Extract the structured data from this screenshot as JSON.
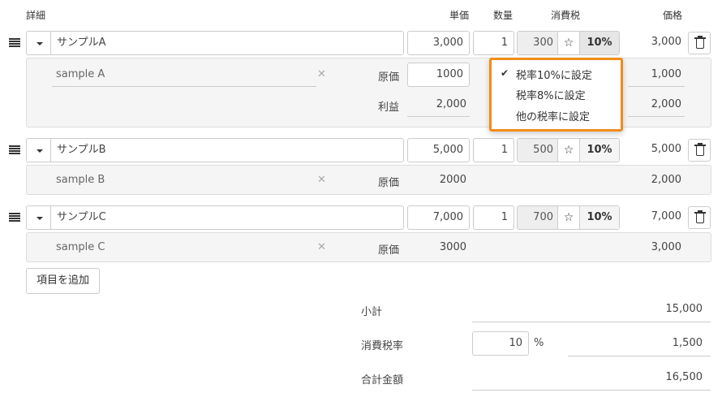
{
  "headers": {
    "detail": "詳細",
    "unit_price": "単価",
    "quantity": "数量",
    "tax": "消費税",
    "price": "価格"
  },
  "items": [
    {
      "name": "サンプルA",
      "unit_price": "3,000",
      "quantity": "1",
      "tax_amount": "300",
      "tax_rate": "10%",
      "price": "3,000",
      "description": "sample A",
      "cost_label": "原価",
      "cost_value": "1000",
      "cost_price": "1,000",
      "profit_label": "利益",
      "profit_value": "2,000",
      "profit_price": "2,000"
    },
    {
      "name": "サンプルB",
      "unit_price": "5,000",
      "quantity": "1",
      "tax_amount": "500",
      "tax_rate": "10%",
      "price": "5,000",
      "description": "sample B",
      "cost_label": "原価",
      "cost_value": "2000",
      "cost_price": "2,000"
    },
    {
      "name": "サンプルC",
      "unit_price": "7,000",
      "quantity": "1",
      "tax_amount": "700",
      "tax_rate": "10%",
      "price": "7,000",
      "description": "sample C",
      "cost_label": "原価",
      "cost_value": "3000",
      "cost_price": "3,000"
    }
  ],
  "tax_menu": {
    "options": [
      "税率10%に設定",
      "税率8%に設定",
      "他の税率に設定"
    ],
    "selected_index": 0,
    "highlight_color": "#f28c1a"
  },
  "add_item_label": "項目を追加",
  "summary": {
    "subtotal_label": "小計",
    "subtotal_value": "15,000",
    "tax_rate_label": "消費税率",
    "tax_rate_input": "10",
    "tax_rate_unit": "%",
    "tax_value": "1,500",
    "total_label": "合計金額",
    "total_value": "16,500"
  },
  "icons": {
    "drag": "drag-handle-icon",
    "dropdown": "caret-down-icon",
    "star": "star-icon",
    "trash": "trash-icon",
    "clear": "clear-x-icon",
    "check": "checkmark-icon"
  }
}
